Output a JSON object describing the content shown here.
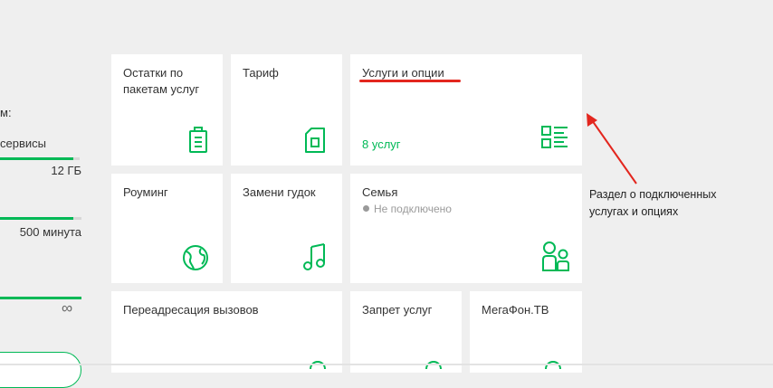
{
  "left_panel": {
    "heading": "м:",
    "items": [
      {
        "label": "сервисы",
        "value": "12 ГБ",
        "fill": 0.92
      },
      {
        "label": "",
        "value": "500 минута",
        "fill": 0.9
      },
      {
        "label": "",
        "value": "∞",
        "fill": 1.0
      }
    ]
  },
  "tiles": {
    "packages": {
      "title": "Остатки по пакетам услуг",
      "icon": "battery-icon"
    },
    "tariff": {
      "title": "Тариф",
      "icon": "sim-card-icon"
    },
    "services": {
      "title": "Услуги и опции",
      "subtitle": "8 услуг",
      "icon": "service-list-icon"
    },
    "roaming": {
      "title": "Роуминг",
      "icon": "globe-icon"
    },
    "ringtone": {
      "title": "Замени гудок",
      "icon": "music-note-icon"
    },
    "family": {
      "title": "Семья",
      "status": "Не подключено",
      "icon": "family-icon"
    },
    "forwarding": {
      "title": "Переадресация вызовов"
    },
    "ban": {
      "title": "Запрет услуг"
    },
    "megafon_tv": {
      "title": "МегаФон.ТВ"
    }
  },
  "annotation": {
    "line1": "Раздел о подключенных",
    "line2": "услугах и опциях"
  },
  "colors": {
    "accent": "#00b956",
    "annotation": "#e3261e",
    "background": "#efefef"
  }
}
